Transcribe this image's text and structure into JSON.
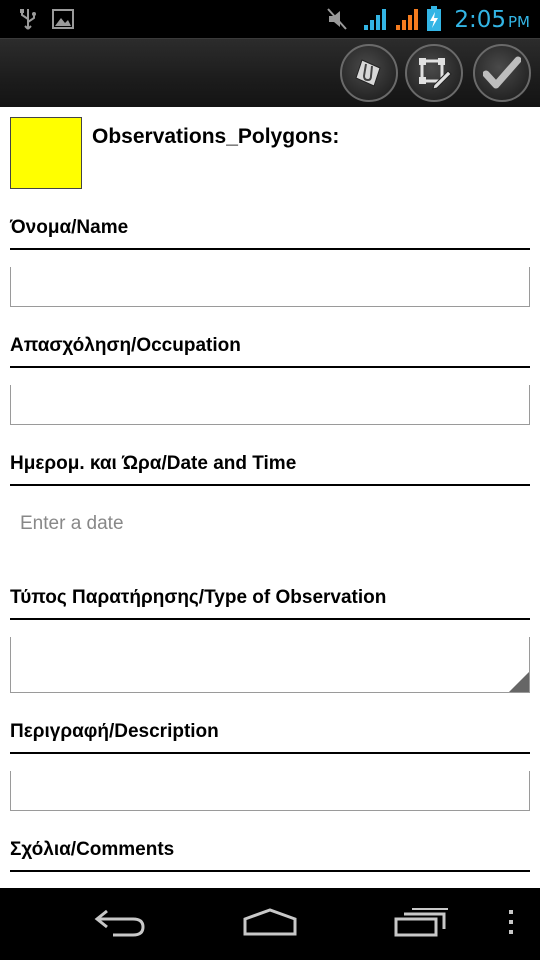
{
  "status_bar": {
    "icons": [
      "usb-icon",
      "image-icon",
      "mute-icon",
      "signal-icon",
      "signal-icon",
      "battery-charging-icon"
    ],
    "time": "2:05",
    "ampm": "PM",
    "clock_color": "#33b5e5"
  },
  "action_bar": {
    "buttons": [
      "attachment-icon",
      "edit-geometry-icon",
      "check-icon"
    ]
  },
  "layer": {
    "title": "Observations_Polygons:",
    "color": "#ffff00"
  },
  "form": {
    "fields": [
      {
        "label": "Όνομα/Name",
        "value": ""
      },
      {
        "label": "Απασχόληση/Occupation",
        "value": ""
      },
      {
        "label": "Ημερομ. και Ώρα/Date and Time",
        "placeholder": "Enter a date"
      },
      {
        "label": "Τύπος Παρατήρησης/Type of Observation",
        "value": ""
      },
      {
        "label": "Περιγραφή/Description",
        "value": ""
      },
      {
        "label": "Σχόλια/Comments",
        "value": ""
      }
    ]
  },
  "nav_bar": {
    "buttons": [
      "back-icon",
      "home-icon",
      "recent-apps-icon",
      "menu-overflow-icon"
    ]
  }
}
